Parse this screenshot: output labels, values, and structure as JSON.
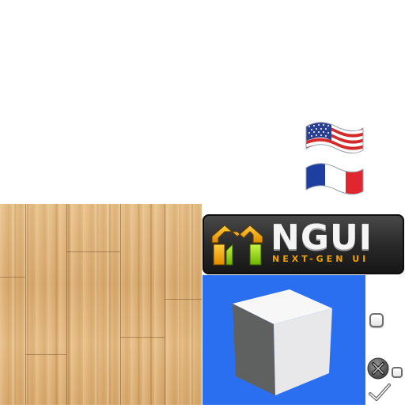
{
  "logo": {
    "word": "NGUI",
    "tagline": "NEXT-GEN UI"
  },
  "icons": {
    "us_flag": "us-flag-icon",
    "fr_flag": "fr-flag-icon",
    "close": "close-icon",
    "check": "check-icon"
  },
  "colors": {
    "panel_blue": "#2b6ff1",
    "logo_orange": "#f2a200",
    "wood": "#dfb57e"
  }
}
